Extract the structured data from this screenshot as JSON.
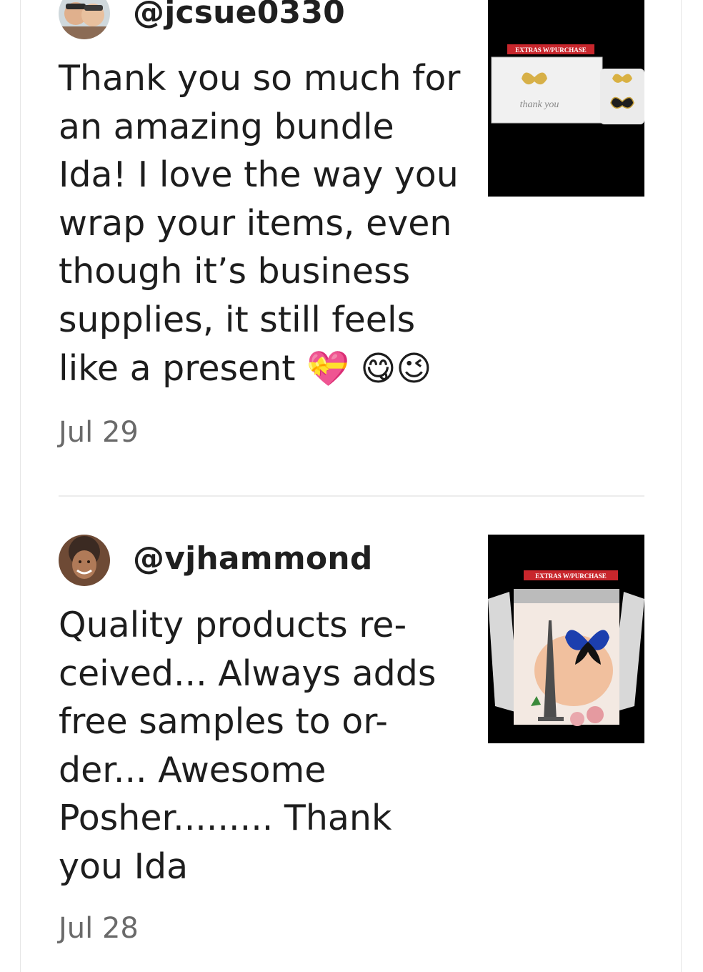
{
  "reviews": [
    {
      "username": "@jcsue0330",
      "text_lines": [
        "Thank you so much for",
        "an amazing bundle",
        "Ida! I love the way you",
        "wrap your items, even",
        "though it’s business",
        "supplies, it still feels"
      ],
      "last_line_text": "like a present",
      "emojis": [
        "💝",
        "😋",
        "😉"
      ],
      "date": "Jul 29",
      "thumbnail": {
        "badge": "EXTRAS W/PURCHASE",
        "script": "thank you"
      }
    },
    {
      "username": "@vjhammond",
      "text_lines": [
        "Quality products re-",
        "ceived... Always adds",
        "free samples to or-",
        "der... Awesome",
        "Posher......... Thank",
        "you Ida"
      ],
      "date": "Jul 28",
      "thumbnail": {
        "badge": "EXTRAS W/PURCHASE"
      }
    }
  ],
  "colors": {
    "divider": "#ececec",
    "date": "#6a6a6a",
    "badge": "#c8262c"
  }
}
